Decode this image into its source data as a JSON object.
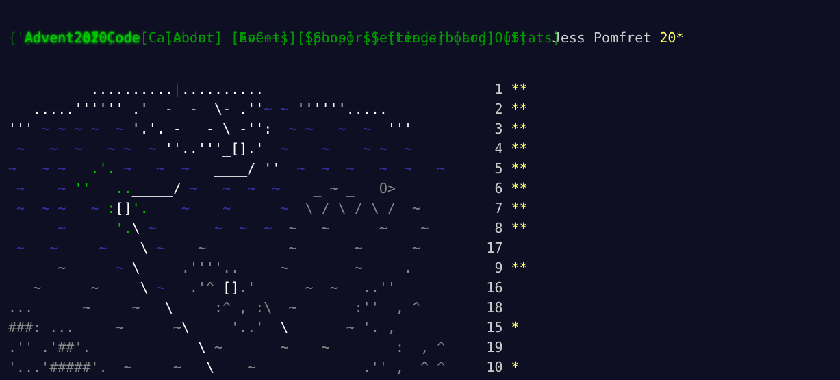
{
  "header": {
    "logo": "Advent of Code",
    "year_prefix": "{'year':",
    "year": "2020",
    "year_suffix": "}",
    "nav_row1": [
      "[About]",
      "[Events]",
      "[Shop]",
      "[Settings]",
      "[Log Out]"
    ],
    "nav_row2": [
      "[Calendar]",
      "[AoC++]",
      "[Sponsors]",
      "[Leaderboard]",
      "[Stats]"
    ],
    "user_name": "Jess Pomfret",
    "star_count": "20*"
  },
  "calendar": {
    "lines": [
      {
        "art": [
          [
            "w",
            "          .........."
          ],
          [
            "r",
            "|"
          ],
          [
            "w",
            ".........."
          ]
        ],
        "day": "1",
        "stars": "**"
      },
      {
        "art": [
          [
            "w",
            "   .....'''''' .'  -  -  \\- .''"
          ],
          [
            "b",
            "~ ~ "
          ],
          [
            "w",
            "''''''....."
          ]
        ],
        "day": "2",
        "stars": "**"
      },
      {
        "art": [
          [
            "w",
            "''' "
          ],
          [
            "b",
            "~ ~ ~ ~  ~ "
          ],
          [
            "w",
            "'.'. -   - \\ -'':"
          ],
          [
            "b",
            "  ~ ~   ~  ~  "
          ],
          [
            "w",
            "'''"
          ]
        ],
        "day": "3",
        "stars": "**"
      },
      {
        "art": [
          [
            "b",
            " ~   ~  ~   ~ ~  ~ "
          ],
          [
            "w",
            "''..'''_[]."
          ],
          [
            "w",
            "'"
          ],
          [
            "b",
            "  ~    ~    ~ ~  ~"
          ]
        ],
        "day": "4",
        "stars": "**"
      },
      {
        "art": [
          [
            "b",
            "~   ~ ~   "
          ],
          [
            "gr",
            ".'. "
          ],
          [
            "b",
            "~   ~  ~   "
          ],
          [
            "w",
            "____/ ''"
          ],
          [
            "b",
            "  ~  ~  ~   ~  ~   ~"
          ]
        ],
        "day": "5",
        "stars": "**"
      },
      {
        "art": [
          [
            "b",
            " ~    ~ "
          ],
          [
            "gr",
            "''"
          ],
          [
            "gr",
            "   .."
          ],
          [
            "w",
            "_____/"
          ],
          [
            "b",
            " ~   ~  ~  ~   "
          ],
          [
            "d",
            " _ ~ _   O>"
          ]
        ],
        "day": "6",
        "stars": "**"
      },
      {
        "art": [
          [
            "b",
            " ~  ~ ~   ~ "
          ],
          [
            "gr",
            ":"
          ],
          [
            "w",
            "[]"
          ],
          [
            "gr",
            "'."
          ],
          [
            "b",
            "    ~    ~      ~  "
          ],
          [
            "d",
            "\\ / \\ / \\ /  ~"
          ]
        ],
        "day": "7",
        "stars": "**"
      },
      {
        "art": [
          [
            "b",
            "      ~      "
          ],
          [
            "gr",
            "'."
          ],
          [
            "w",
            "\\"
          ],
          [
            "b",
            " ~       ~  ~  ~  "
          ],
          [
            "d",
            "~   ~      ~    ~"
          ]
        ],
        "day": "8",
        "stars": "**"
      },
      {
        "art": [
          [
            "b",
            " ~   ~     ~    "
          ],
          [
            "w",
            "\\"
          ],
          [
            "b",
            " ~  "
          ],
          [
            "d",
            "  ~          ~       ~      ~"
          ]
        ],
        "day": "17",
        "stars": ""
      },
      {
        "art": [
          [
            "d",
            "      ~      "
          ],
          [
            "b",
            "~ "
          ],
          [
            "w",
            "\\"
          ],
          [
            "d",
            "     .''''..     ~        ~     ."
          ]
        ],
        "day": "9",
        "stars": "**"
      },
      {
        "art": [
          [
            "d",
            "   ~      ~     "
          ],
          [
            "w",
            "\\"
          ],
          [
            "b",
            " ~  "
          ],
          [
            "d",
            " .'^ "
          ],
          [
            "w",
            "[]"
          ],
          [
            "d",
            ".'      ~  ~   ..''"
          ]
        ],
        "day": "16",
        "stars": ""
      },
      {
        "art": [
          [
            "d",
            "...      ~     ~   "
          ],
          [
            "w",
            "\\"
          ],
          [
            "d",
            "     :^ , :\\  ~       :''  , ^"
          ]
        ],
        "day": "18",
        "stars": ""
      },
      {
        "art": [
          [
            "d",
            "###: ...     ~      ~"
          ],
          [
            "w",
            "\\"
          ],
          [
            "d",
            "     '..'  "
          ],
          [
            "w",
            "\\___"
          ],
          [
            "d",
            "    ~ '. ,"
          ]
        ],
        "day": "15",
        "stars": "*"
      },
      {
        "art": [
          [
            "d",
            ".'' .'##'.             "
          ],
          [
            "w",
            "\\"
          ],
          [
            "d",
            " ~       ~    ~        :  , ^"
          ]
        ],
        "day": "19",
        "stars": ""
      },
      {
        "art": [
          [
            "d",
            "'...'#####'.  ~     ~   "
          ],
          [
            "w",
            "\\"
          ],
          [
            "d",
            "    ~             .'' ,  ^ ^"
          ]
        ],
        "day": "10",
        "stars": "*"
      }
    ]
  },
  "colors": {
    "background": "#0f0f23",
    "logo_green": "#00cc00",
    "link_green": "#009900",
    "star_yellow": "#ffff66",
    "cursor_red": "#ff0000",
    "water_blue": "#3333aa"
  }
}
